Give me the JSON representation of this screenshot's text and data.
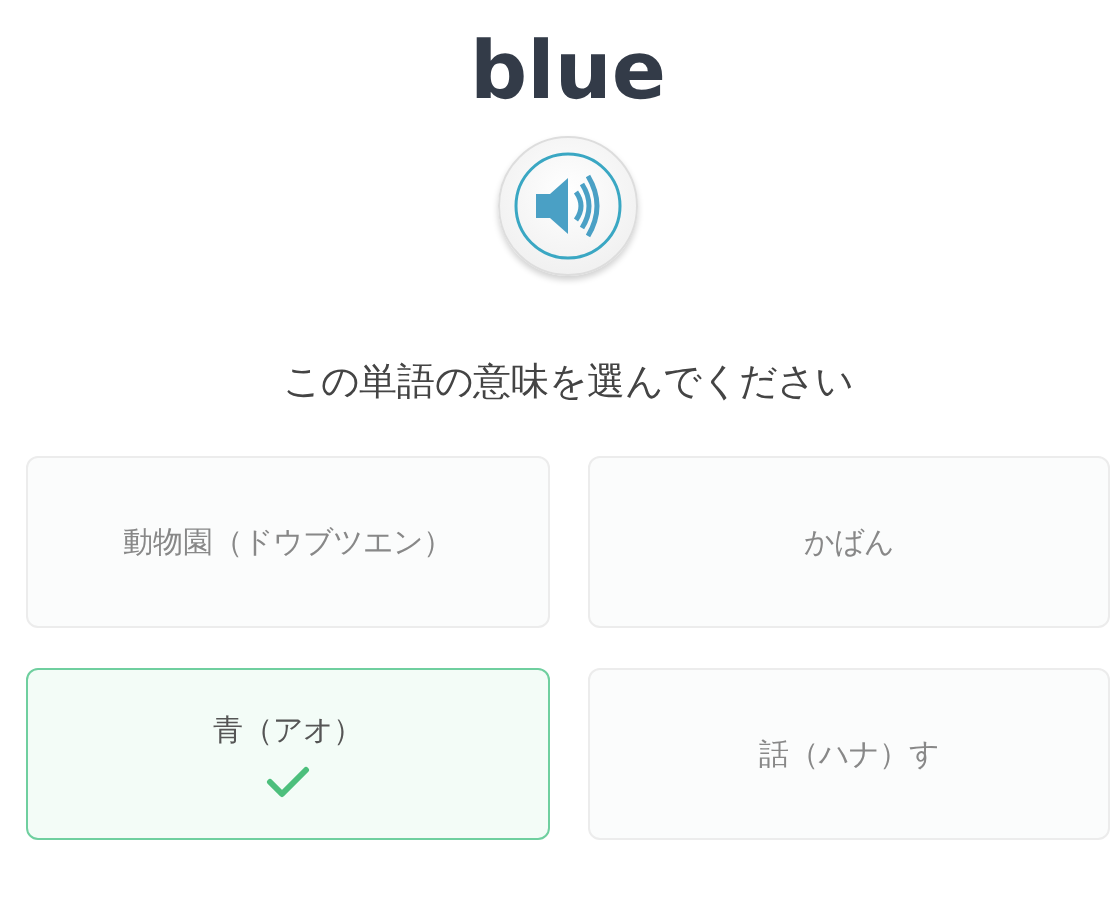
{
  "word": "blue",
  "prompt": "この単語の意味を選んでください",
  "options": [
    {
      "label": "動物園（ドウブツエン）",
      "selected": false
    },
    {
      "label": "かばん",
      "selected": false
    },
    {
      "label": "青（アオ）",
      "selected": true
    },
    {
      "label": "話（ハナ）す",
      "selected": false
    }
  ]
}
